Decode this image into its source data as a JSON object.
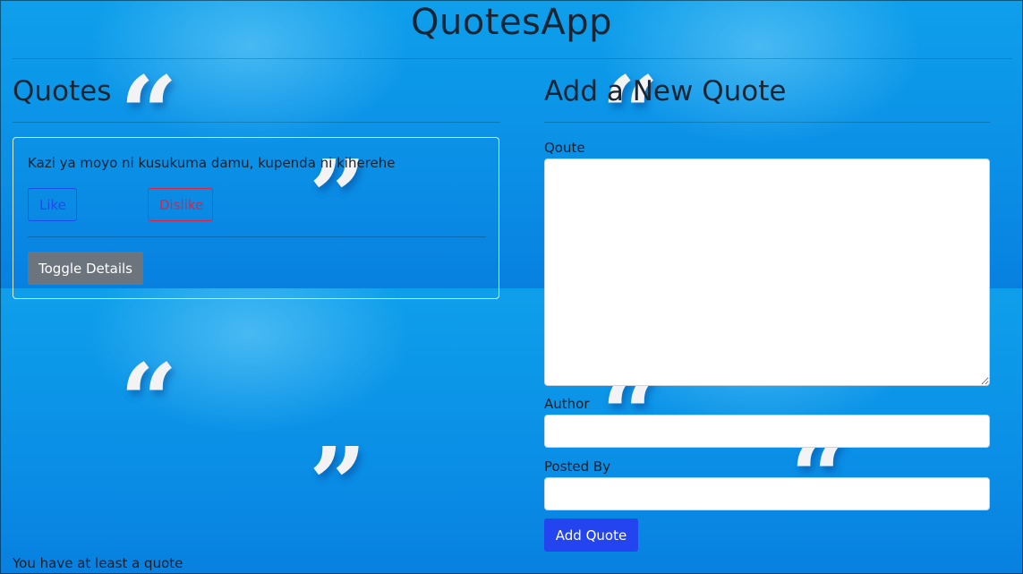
{
  "app": {
    "title": "QuotesApp"
  },
  "quotes_section": {
    "title": "Quotes",
    "items": [
      {
        "text": "Kazi ya moyo ni kusukuma damu, kupenda ni kiherehe",
        "like_label": "Like",
        "dislike_label": "Dislike",
        "toggle_label": "Toggle Details"
      }
    ],
    "status": "You have at least a quote"
  },
  "form": {
    "title": "Add a New Quote",
    "quote_label": "Qoute",
    "quote_value": "",
    "author_label": "Author",
    "author_value": "",
    "posted_by_label": "Posted By",
    "posted_by_value": "",
    "submit_label": "Add Quote"
  },
  "icons": {
    "open_quote": "open-quote-icon",
    "close_quote": "close-quote-icon"
  },
  "colors": {
    "background": "#0a9ae8",
    "primary": "#2444f0",
    "like": "#1d4fe8",
    "dislike": "#dc2442",
    "secondary": "#6c757d"
  }
}
